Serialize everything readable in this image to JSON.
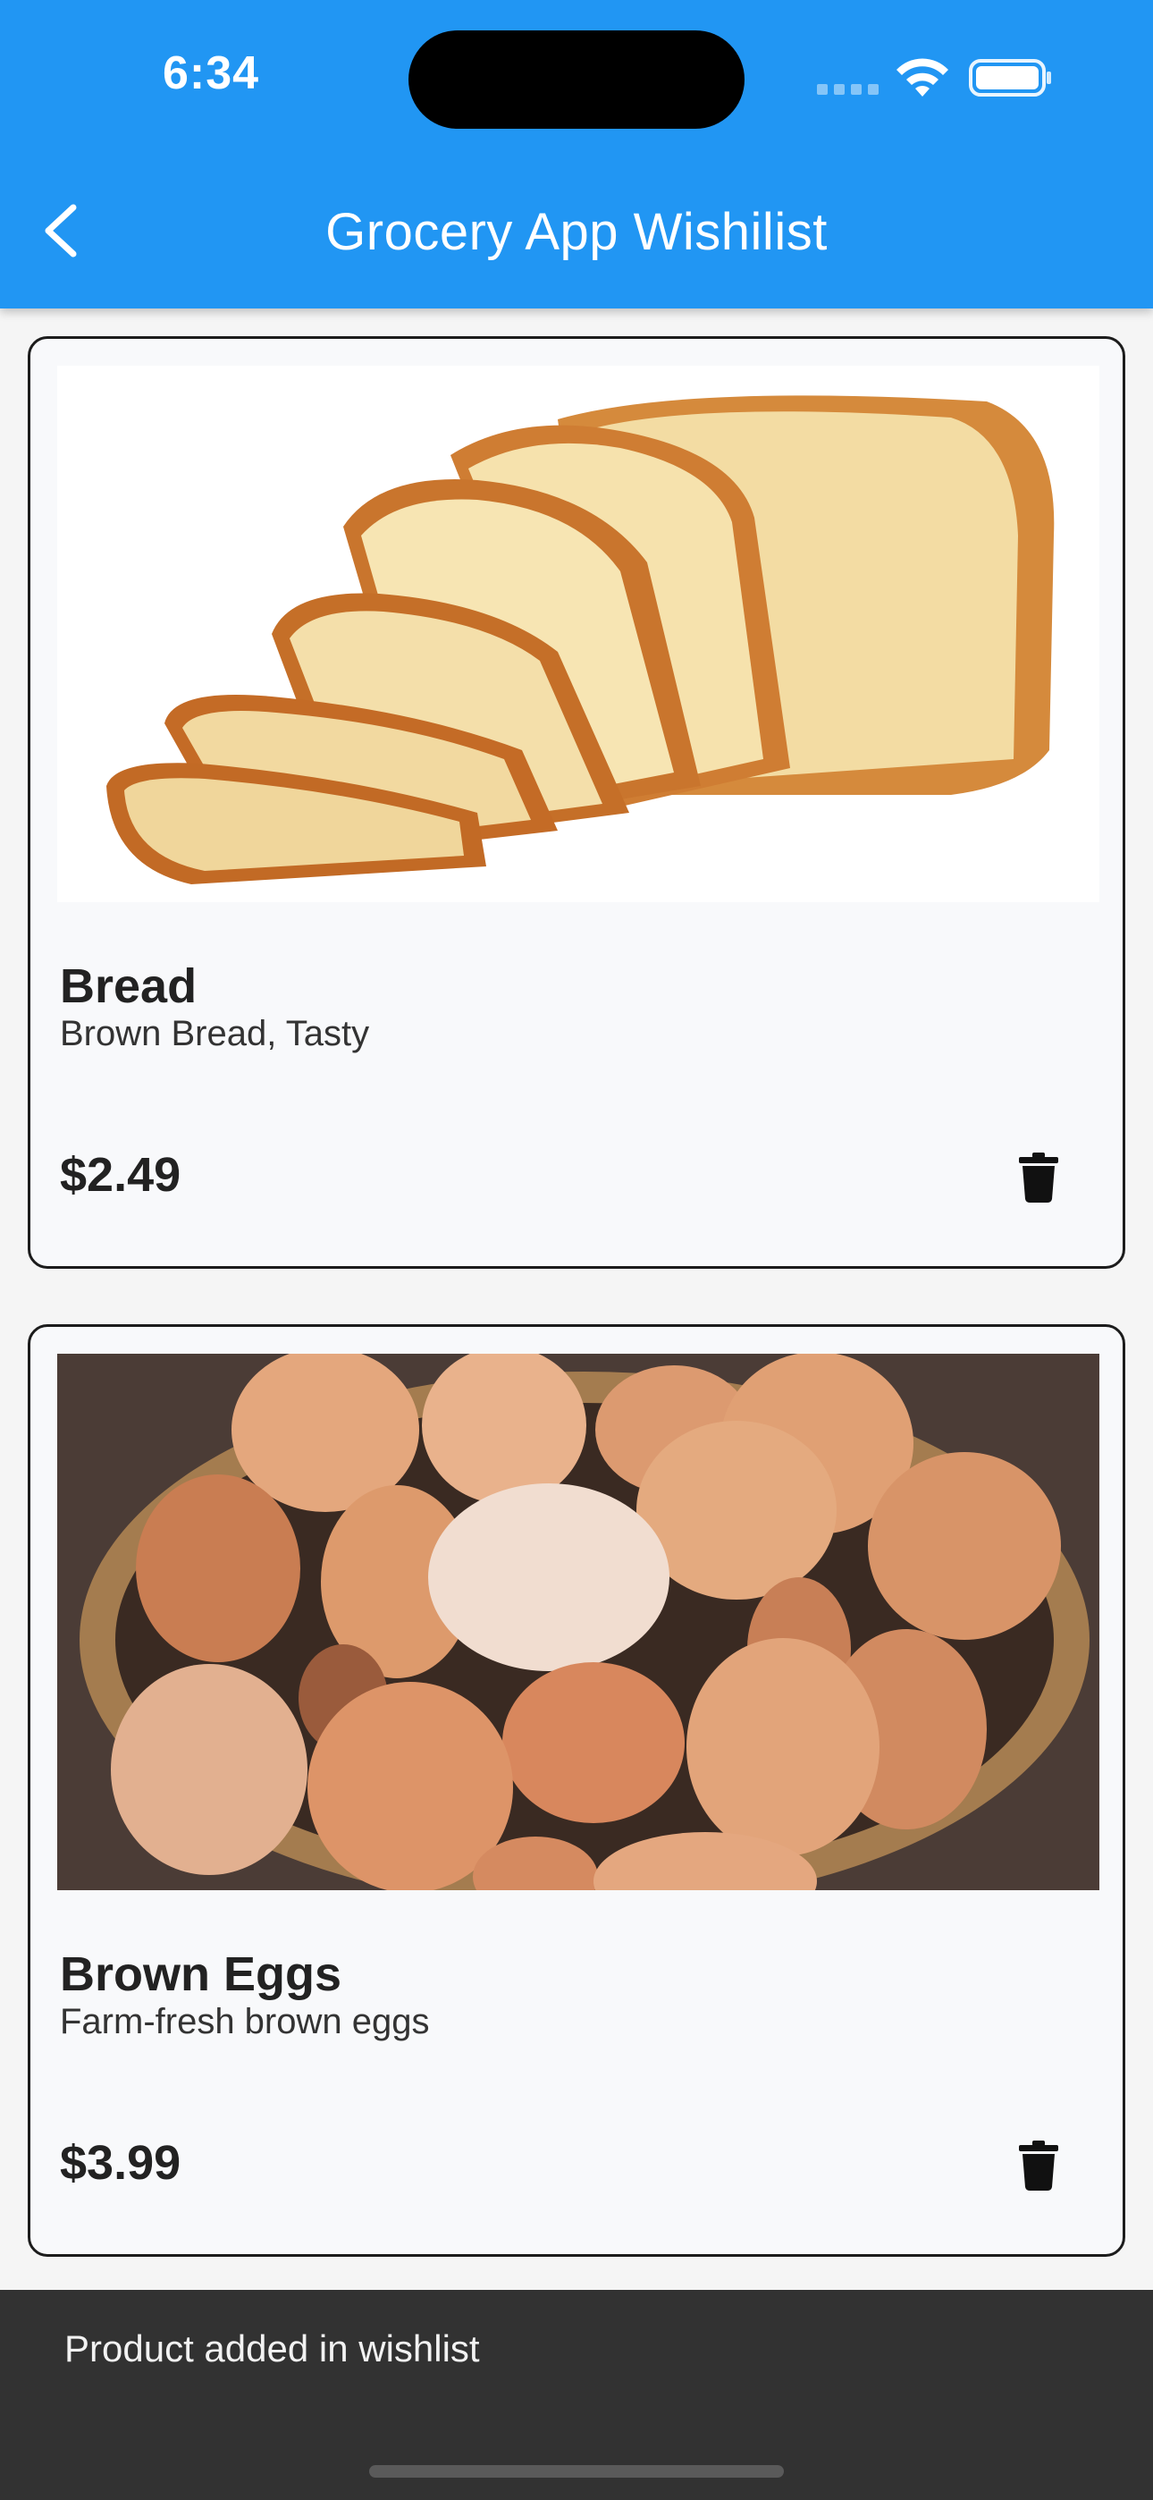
{
  "status_bar": {
    "time": "6:34",
    "wifi_icon": "wifi-icon",
    "battery_icon": "battery-icon"
  },
  "app_bar": {
    "title": "Grocery App Wishilist",
    "back_icon": "chevron-left-icon",
    "background_color": "#2196f3"
  },
  "wishlist": [
    {
      "image": "bread-image",
      "name": "Bread",
      "description": "Brown Bread, Tasty",
      "price": "$2.49",
      "delete_icon": "trash-icon"
    },
    {
      "image": "brown-eggs-image",
      "name": "Brown Eggs",
      "description": "Farm-fresh brown eggs",
      "price": "$3.99",
      "delete_icon": "trash-icon"
    }
  ],
  "snackbar": {
    "message": "Product added in wishlist"
  }
}
